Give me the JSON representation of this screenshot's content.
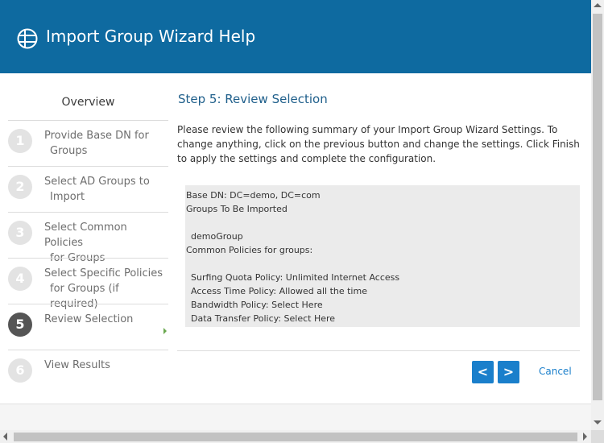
{
  "header": {
    "title": "Import Group Wizard Help",
    "icon": "globe-icon",
    "background": "#0e6aa0"
  },
  "sidebar": {
    "overview_label": "Overview",
    "steps": [
      {
        "number": "1",
        "line1": "Provide Base DN for",
        "line2": "Groups"
      },
      {
        "number": "2",
        "line1": "Select AD Groups to",
        "line2": "Import"
      },
      {
        "number": "3",
        "line1": "Select Common Policies",
        "line2": "for Groups"
      },
      {
        "number": "4",
        "line1": "Select Specific Policies",
        "line2": "for Groups (if required)"
      },
      {
        "number": "5",
        "line1": "Review Selection",
        "line2": "",
        "active": true
      },
      {
        "number": "6",
        "line1": "View Results",
        "line2": ""
      }
    ]
  },
  "main": {
    "step_title": "Step 5: Review Selection",
    "intro": "Please review the following summary of your Import Group Wizard Settings. To change anything, click on the previous button and change the settings. Click Finish to apply the settings and complete the configuration.",
    "summary": {
      "base_dn": "Base DN: DC=demo, DC=com",
      "groups_heading": "Groups To Be Imported",
      "group_name": "demoGroup",
      "policies_heading": "Common Policies for groups:",
      "policies": [
        "Surfing Quota Policy: Unlimited Internet Access",
        "Access Time Policy: Allowed all the time",
        "Bandwidth Policy: Select Here",
        "Data Transfer Policy: Select Here"
      ]
    },
    "buttons": {
      "prev": "<",
      "next": ">",
      "cancel": "Cancel"
    }
  },
  "colors": {
    "accent": "#1a7fcb",
    "step_title": "#1f5f8b"
  }
}
